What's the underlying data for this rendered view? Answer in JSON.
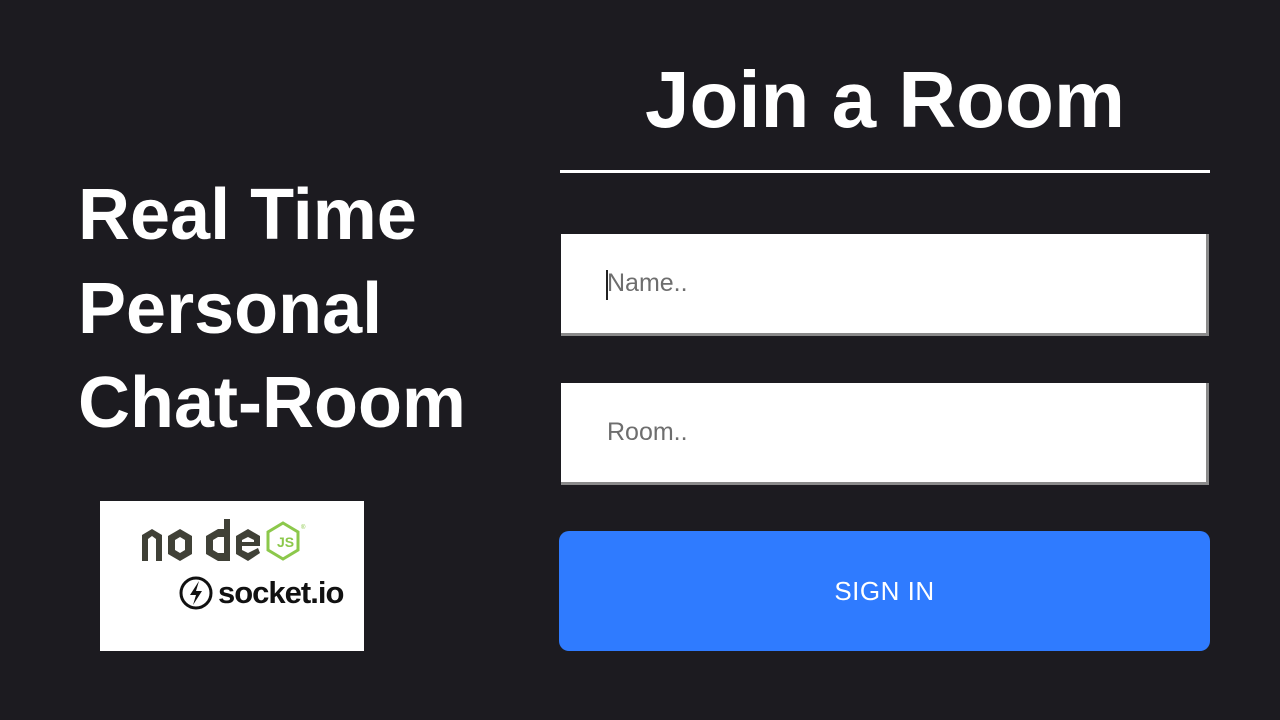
{
  "headline": {
    "line1": "Real Time",
    "line2": "Personal",
    "line3": "Chat-Room"
  },
  "logos": {
    "node_icon": "nodejs-logo-icon",
    "socket_icon": "socket-io-logo-icon",
    "socket_text": "socket.io"
  },
  "form": {
    "title": "Join a Room",
    "name_placeholder": "Name..",
    "room_placeholder": "Room..",
    "submit_label": "SIGN IN"
  },
  "colors": {
    "background": "#1c1b20",
    "accent": "#2f7bff",
    "node_green": "#8cc84b",
    "node_dark": "#404137"
  }
}
